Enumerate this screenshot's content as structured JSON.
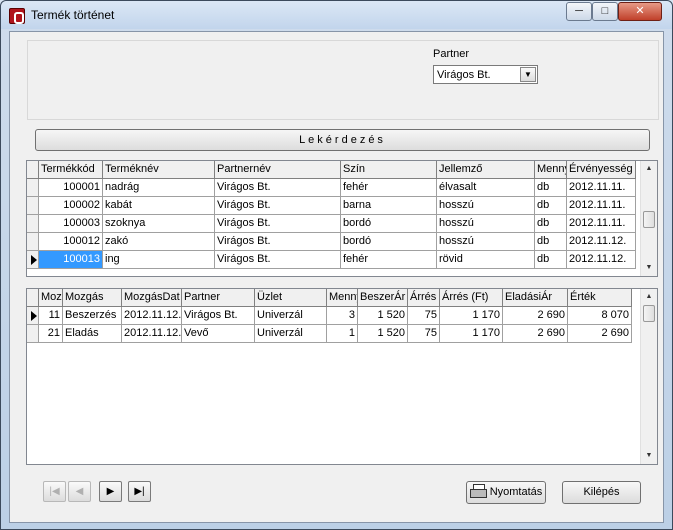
{
  "window": {
    "title": "Termék történet",
    "minimize": "─",
    "maximize": "□",
    "close": "✕"
  },
  "filter": {
    "partner_label": "Partner",
    "partner_value": "Virágos Bt.",
    "dropdown_icon": "chevron-down-icon"
  },
  "query_button": "Lekérdezés",
  "products": {
    "columns": [
      "Termékkód",
      "Terméknév",
      "Partnernév",
      "Szín",
      "Jellemző",
      "Menny",
      "Érvényesség"
    ],
    "rows": [
      [
        "100001",
        "nadrág",
        "Virágos Bt.",
        "fehér",
        "élvasalt",
        "db",
        "2012.11.11."
      ],
      [
        "100002",
        "kabát",
        "Virágos Bt.",
        "barna",
        "hosszú",
        "db",
        "2012.11.11."
      ],
      [
        "100003",
        "szoknya",
        "Virágos Bt.",
        "bordó",
        "hosszú",
        "db",
        "2012.11.11."
      ],
      [
        "100012",
        "zakó",
        "Virágos Bt.",
        "bordó",
        "hosszú",
        "db",
        "2012.11.12."
      ],
      [
        "100013",
        "ing",
        "Virágos Bt.",
        "fehér",
        "rövid",
        "db",
        "2012.11.12."
      ]
    ],
    "selected_row": 4
  },
  "movements": {
    "columns": [
      "Moz",
      "Mozgás",
      "MozgásDat",
      "Partner",
      "Üzlet",
      "Menny",
      "BeszerÁr",
      "Árrés",
      "Árrés (Ft)",
      "EladásiÁr",
      "Érték"
    ],
    "rows": [
      [
        "11",
        "Beszerzés",
        "2012.11.12.",
        "Virágos Bt.",
        "Univerzál",
        "3",
        "1 520",
        "75",
        "1 170",
        "2 690",
        "8 070"
      ],
      [
        "21",
        "Eladás",
        "2012.11.12.",
        "Vevő",
        "Univerzál",
        "1",
        "1 520",
        "75",
        "1 170",
        "2 690",
        "2 690"
      ]
    ],
    "selected_row": 0
  },
  "navigator": {
    "first": "|◀",
    "prev": "◀",
    "next": "▶",
    "last": "▶|"
  },
  "buttons": {
    "print": "Nyomtatás",
    "exit": "Kilépés"
  },
  "colors": {
    "selection": "#3399ff",
    "close_button": "#c0402a"
  }
}
